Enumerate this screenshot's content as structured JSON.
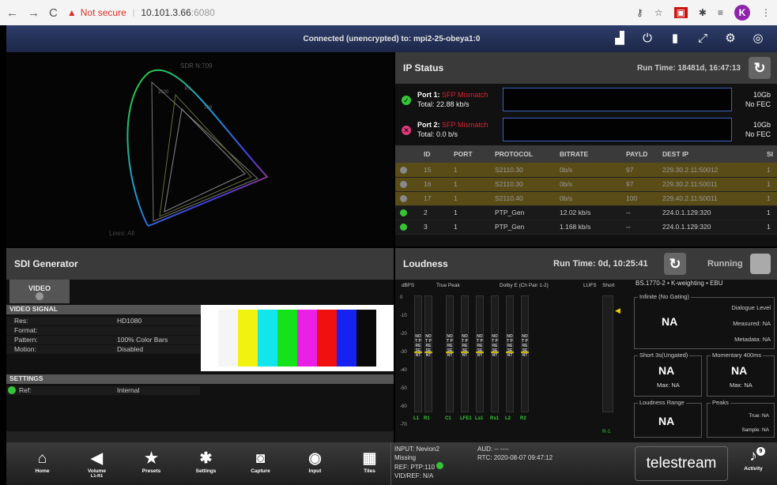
{
  "browser": {
    "url_host": "10.101.3.66",
    "url_port": ":6080",
    "security_label": "Not secure",
    "profile_initial": "K"
  },
  "vnc": {
    "status": "Connected (unencrypted) to: mpi2-25-obeya1:0"
  },
  "gamut": {
    "label": "SDR N:709",
    "lines_label": "Lines: All",
    "marks": [
      "2020",
      "P3",
      "709"
    ]
  },
  "ip_status": {
    "title": "IP Status",
    "run_time": "Run Time: 18481d, 16:47:13",
    "port1": {
      "label": "Port 1:",
      "status": "SFP Mismatch",
      "total": "Total:  22.88 kb/s",
      "speed": "10Gb",
      "fec": "No FEC"
    },
    "port2": {
      "label": "Port 2:",
      "status": "SFP Mismatch",
      "total": "Total:  0.0 b/s",
      "speed": "10Gb",
      "fec": "No FEC"
    },
    "columns": [
      "ID",
      "PORT",
      "PROTOCOL",
      "BITRATE",
      "PAYLD",
      "DEST IP",
      "SI"
    ],
    "rows": [
      [
        "15",
        "1",
        "S2110.30",
        "0b/s",
        "97",
        "229.30.2.11:50012",
        "1"
      ],
      [
        "16",
        "1",
        "S2110.30",
        "0b/s",
        "97",
        "229.30.2.11:50011",
        "1"
      ],
      [
        "17",
        "1",
        "S2110.40",
        "0b/s",
        "100",
        "229.40.2.11:50011",
        "1"
      ],
      [
        "2",
        "1",
        "PTP_Gen",
        "12.02 kb/s",
        "--",
        "224.0.1.129:320",
        "1"
      ],
      [
        "3",
        "1",
        "PTP_Gen",
        "1.168 kb/s",
        "--",
        "224.0.1.129:320",
        "1"
      ]
    ]
  },
  "sdi": {
    "title": "SDI Generator",
    "video_tab": "VIDEO",
    "section": "VIDEO SIGNAL",
    "rows": [
      {
        "k": "Res:",
        "v": "HD1080"
      },
      {
        "k": "Format:",
        "v": ""
      },
      {
        "k": "Pattern:",
        "v": "100% Color Bars"
      },
      {
        "k": "Motion:",
        "v": "Disabled"
      }
    ],
    "settings": "SETTINGS",
    "ref_k": "Ref:",
    "ref_v": "Internal",
    "bars": [
      "#f5f5f5",
      "#f2f211",
      "#12e6ec",
      "#15e21a",
      "#ea20e6",
      "#f01010",
      "#1522f0",
      "#0a0a0a"
    ]
  },
  "loudness": {
    "title": "Loudness",
    "run_time": "Run Time: 0d, 10:25:41",
    "state": "Running",
    "hdr_dbfs": "dBFS",
    "hdr_tp": "True Peak",
    "hdr_dolby": "Dolby E (Ch Pair 1-2)",
    "hdr_lufs": "LUFS",
    "hdr_short": "Short",
    "standard": "BS.1770-2 • K-weighting • EBU",
    "infinite": "Infinite (No Gating)",
    "dialogue": "Dialogue Level",
    "measured": "Measured: NA",
    "metadata": "Metadata: NA",
    "infinite_val": "NA",
    "short3s": "Short 3s(Ungated)",
    "short_val": "NA",
    "short_max": "Max: NA",
    "momentary": "Momentary 400ms",
    "mom_val": "NA",
    "mom_max": "Max: NA",
    "range": "Loudness Range",
    "range_val": "NA",
    "peaks": "Peaks",
    "true_peak": "True: NA",
    "sample_peak": "Sample: NA",
    "channels": [
      "L1",
      "R1",
      "C1",
      "LFE1",
      "Ls1",
      "Rs1",
      "L2",
      "R2"
    ],
    "short_ch": "R-1",
    "meter_text": "NOT PRESENT",
    "scale": [
      "0",
      "-10",
      "-20",
      "-30",
      "-40",
      "-50",
      "-60",
      "-70"
    ]
  },
  "dock": {
    "items": [
      {
        "n": "home",
        "i": "⌂",
        "l": "Home"
      },
      {
        "n": "volume",
        "i": "◀",
        "l": "Volume"
      },
      {
        "n": "presets",
        "i": "★",
        "l": "Presets"
      },
      {
        "n": "settings",
        "i": "✱",
        "l": "Settings"
      },
      {
        "n": "capture",
        "i": "◙",
        "l": "Capture"
      },
      {
        "n": "input",
        "i": "◉",
        "l": "Input"
      },
      {
        "n": "tiles",
        "i": "▦",
        "l": "Tiles"
      }
    ],
    "volume_sub": "L1-R1",
    "input_line": "INPUT: Nevion2",
    "missing": "Missing",
    "ref": "REF: PTP:110",
    "vidref": "VID/REF: N/A",
    "aud": "AUD:  -- ----",
    "rtc": "RTC: 2020-08-07 09:47:12",
    "brand": "telestream",
    "activity": "Activity",
    "activity_count": "9"
  }
}
